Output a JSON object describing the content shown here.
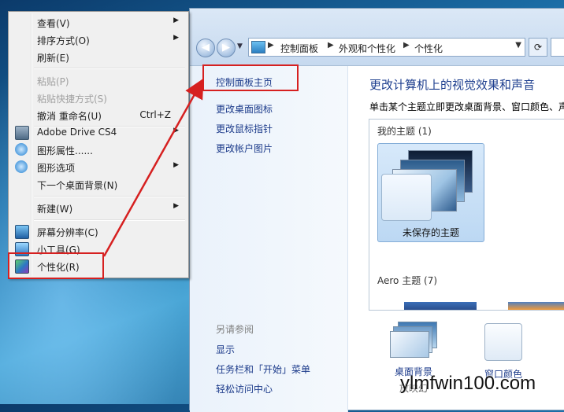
{
  "context_menu": {
    "items": [
      {
        "label": "查看(V)",
        "submenu": true
      },
      {
        "label": "排序方式(O)",
        "submenu": true
      },
      {
        "label": "刷新(E)"
      },
      {
        "label": "粘贴(P)",
        "disabled": true
      },
      {
        "label": "粘贴快捷方式(S)",
        "disabled": true
      },
      {
        "label": "撤消 重命名(U)",
        "shortcut": "Ctrl+Z"
      },
      {
        "label": "Adobe Drive CS4",
        "submenu": true,
        "icon": "adobe-drive-icon"
      },
      {
        "label": "图形属性......",
        "icon": "graphics-properties-icon"
      },
      {
        "label": "图形选项",
        "submenu": true,
        "icon": "graphics-options-icon"
      },
      {
        "label": "下一个桌面背景(N)"
      },
      {
        "label": "新建(W)",
        "submenu": true
      },
      {
        "label": "屏幕分辨率(C)",
        "icon": "screen-resolution-icon"
      },
      {
        "label": "小工具(G)",
        "icon": "gadgets-icon"
      },
      {
        "label": "个性化(R)",
        "icon": "personalize-icon"
      }
    ]
  },
  "address_bar": {
    "crumbs": [
      "控制面板",
      "外观和个性化",
      "个性化"
    ]
  },
  "sidebar": {
    "home_link": "控制面板主页",
    "links": [
      "更改桌面图标",
      "更改鼠标指针",
      "更改帐户图片"
    ],
    "see_also_heading": "另请参阅",
    "see_also": [
      "显示",
      "任务栏和「开始」菜单",
      "轻松访问中心"
    ]
  },
  "main": {
    "title": "更改计算机上的视觉效果和声音",
    "subtitle": "单击某个主题立即更改桌面背景、窗口颜色、声",
    "my_themes_label": "我的主题 (1)",
    "unsaved_theme_label": "未保存的主题",
    "aero_themes_label": "Aero 主题 (7)",
    "desktop_background_label": "桌面背景",
    "desktop_background_sub": "放映幻",
    "window_color_label": "窗口颜色"
  },
  "watermark": "ylmfwin100.com",
  "colors": {
    "highlight_red": "#d62020",
    "link_blue": "#1b3a8a"
  }
}
